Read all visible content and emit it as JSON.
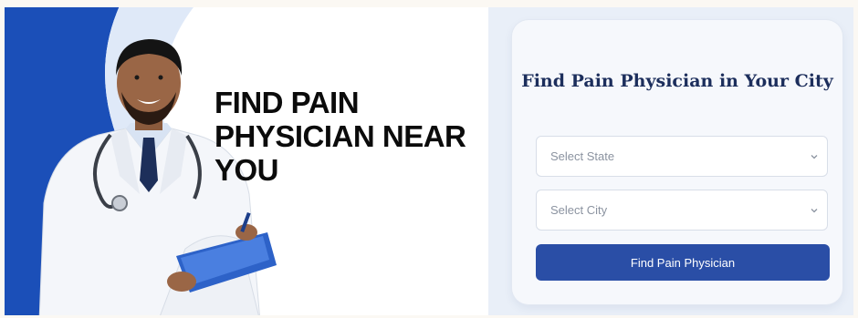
{
  "hero": {
    "headline_lines": [
      "FIND PAIN",
      "PHYSICIAN NEAR",
      "YOU"
    ],
    "image_icon": "doctor-illustration"
  },
  "search_card": {
    "title": "Find Pain Physician in Your City",
    "state_select": {
      "placeholder": "Select State",
      "icon": "chevron-down-icon"
    },
    "city_select": {
      "placeholder": "Select City",
      "icon": "chevron-down-icon"
    },
    "submit_label": "Find Pain Physician"
  },
  "colors": {
    "brand_blue": "#2a4ea6",
    "title_navy": "#1c2e5c",
    "hero_blue": "#1b4fb8"
  }
}
